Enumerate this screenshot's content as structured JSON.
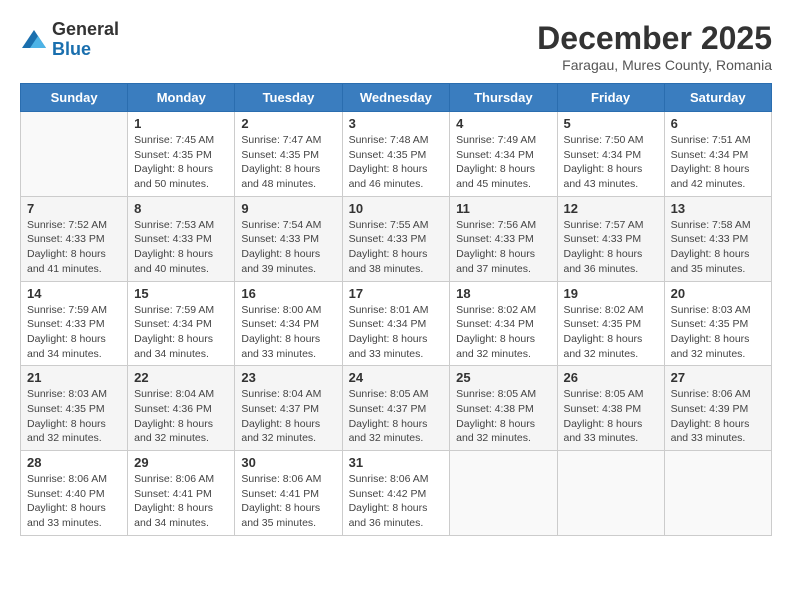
{
  "logo": {
    "general": "General",
    "blue": "Blue"
  },
  "header": {
    "month": "December 2025",
    "location": "Faragau, Mures County, Romania"
  },
  "days_of_week": [
    "Sunday",
    "Monday",
    "Tuesday",
    "Wednesday",
    "Thursday",
    "Friday",
    "Saturday"
  ],
  "weeks": [
    [
      {
        "day": "",
        "info": ""
      },
      {
        "day": "1",
        "info": "Sunrise: 7:45 AM\nSunset: 4:35 PM\nDaylight: 8 hours\nand 50 minutes."
      },
      {
        "day": "2",
        "info": "Sunrise: 7:47 AM\nSunset: 4:35 PM\nDaylight: 8 hours\nand 48 minutes."
      },
      {
        "day": "3",
        "info": "Sunrise: 7:48 AM\nSunset: 4:35 PM\nDaylight: 8 hours\nand 46 minutes."
      },
      {
        "day": "4",
        "info": "Sunrise: 7:49 AM\nSunset: 4:34 PM\nDaylight: 8 hours\nand 45 minutes."
      },
      {
        "day": "5",
        "info": "Sunrise: 7:50 AM\nSunset: 4:34 PM\nDaylight: 8 hours\nand 43 minutes."
      },
      {
        "day": "6",
        "info": "Sunrise: 7:51 AM\nSunset: 4:34 PM\nDaylight: 8 hours\nand 42 minutes."
      }
    ],
    [
      {
        "day": "7",
        "info": "Sunrise: 7:52 AM\nSunset: 4:33 PM\nDaylight: 8 hours\nand 41 minutes."
      },
      {
        "day": "8",
        "info": "Sunrise: 7:53 AM\nSunset: 4:33 PM\nDaylight: 8 hours\nand 40 minutes."
      },
      {
        "day": "9",
        "info": "Sunrise: 7:54 AM\nSunset: 4:33 PM\nDaylight: 8 hours\nand 39 minutes."
      },
      {
        "day": "10",
        "info": "Sunrise: 7:55 AM\nSunset: 4:33 PM\nDaylight: 8 hours\nand 38 minutes."
      },
      {
        "day": "11",
        "info": "Sunrise: 7:56 AM\nSunset: 4:33 PM\nDaylight: 8 hours\nand 37 minutes."
      },
      {
        "day": "12",
        "info": "Sunrise: 7:57 AM\nSunset: 4:33 PM\nDaylight: 8 hours\nand 36 minutes."
      },
      {
        "day": "13",
        "info": "Sunrise: 7:58 AM\nSunset: 4:33 PM\nDaylight: 8 hours\nand 35 minutes."
      }
    ],
    [
      {
        "day": "14",
        "info": "Sunrise: 7:59 AM\nSunset: 4:33 PM\nDaylight: 8 hours\nand 34 minutes."
      },
      {
        "day": "15",
        "info": "Sunrise: 7:59 AM\nSunset: 4:34 PM\nDaylight: 8 hours\nand 34 minutes."
      },
      {
        "day": "16",
        "info": "Sunrise: 8:00 AM\nSunset: 4:34 PM\nDaylight: 8 hours\nand 33 minutes."
      },
      {
        "day": "17",
        "info": "Sunrise: 8:01 AM\nSunset: 4:34 PM\nDaylight: 8 hours\nand 33 minutes."
      },
      {
        "day": "18",
        "info": "Sunrise: 8:02 AM\nSunset: 4:34 PM\nDaylight: 8 hours\nand 32 minutes."
      },
      {
        "day": "19",
        "info": "Sunrise: 8:02 AM\nSunset: 4:35 PM\nDaylight: 8 hours\nand 32 minutes."
      },
      {
        "day": "20",
        "info": "Sunrise: 8:03 AM\nSunset: 4:35 PM\nDaylight: 8 hours\nand 32 minutes."
      }
    ],
    [
      {
        "day": "21",
        "info": "Sunrise: 8:03 AM\nSunset: 4:35 PM\nDaylight: 8 hours\nand 32 minutes."
      },
      {
        "day": "22",
        "info": "Sunrise: 8:04 AM\nSunset: 4:36 PM\nDaylight: 8 hours\nand 32 minutes."
      },
      {
        "day": "23",
        "info": "Sunrise: 8:04 AM\nSunset: 4:37 PM\nDaylight: 8 hours\nand 32 minutes."
      },
      {
        "day": "24",
        "info": "Sunrise: 8:05 AM\nSunset: 4:37 PM\nDaylight: 8 hours\nand 32 minutes."
      },
      {
        "day": "25",
        "info": "Sunrise: 8:05 AM\nSunset: 4:38 PM\nDaylight: 8 hours\nand 32 minutes."
      },
      {
        "day": "26",
        "info": "Sunrise: 8:05 AM\nSunset: 4:38 PM\nDaylight: 8 hours\nand 33 minutes."
      },
      {
        "day": "27",
        "info": "Sunrise: 8:06 AM\nSunset: 4:39 PM\nDaylight: 8 hours\nand 33 minutes."
      }
    ],
    [
      {
        "day": "28",
        "info": "Sunrise: 8:06 AM\nSunset: 4:40 PM\nDaylight: 8 hours\nand 33 minutes."
      },
      {
        "day": "29",
        "info": "Sunrise: 8:06 AM\nSunset: 4:41 PM\nDaylight: 8 hours\nand 34 minutes."
      },
      {
        "day": "30",
        "info": "Sunrise: 8:06 AM\nSunset: 4:41 PM\nDaylight: 8 hours\nand 35 minutes."
      },
      {
        "day": "31",
        "info": "Sunrise: 8:06 AM\nSunset: 4:42 PM\nDaylight: 8 hours\nand 36 minutes."
      },
      {
        "day": "",
        "info": ""
      },
      {
        "day": "",
        "info": ""
      },
      {
        "day": "",
        "info": ""
      }
    ]
  ]
}
